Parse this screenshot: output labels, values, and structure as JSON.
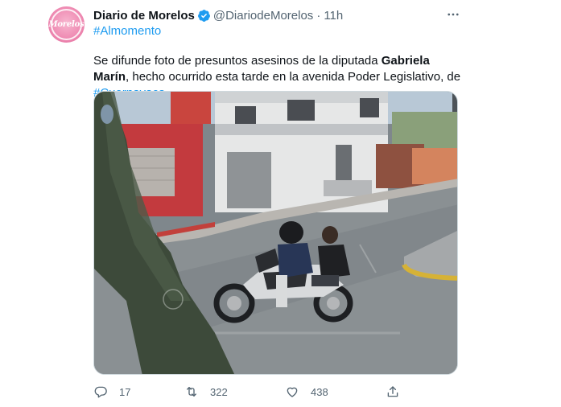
{
  "tweet": {
    "avatar_text": "Morelos",
    "author_name": "Diario de Morelos",
    "handle": "@DiariodeMorelos",
    "separator": "·",
    "time": "11h",
    "hashtag": "#Almomento",
    "text_part1": "Se difunde foto de presuntos asesinos de la diputada ",
    "text_bold": "Gabriela Marín",
    "text_part2": ", hecho ocurrido esta tarde en la avenida Poder Legislativo, de ",
    "text_link": "#Cuernavaca"
  },
  "actions": {
    "replies": "17",
    "retweets": "322",
    "likes": "438"
  },
  "icons": {
    "verified": "verified-badge-icon",
    "more": "more-icon",
    "reply": "reply-icon",
    "retweet": "retweet-icon",
    "like": "heart-icon",
    "share": "share-icon"
  },
  "colors": {
    "accent": "#1d9bf0",
    "secondary_text": "#536471",
    "primary_text": "#0f1419"
  }
}
